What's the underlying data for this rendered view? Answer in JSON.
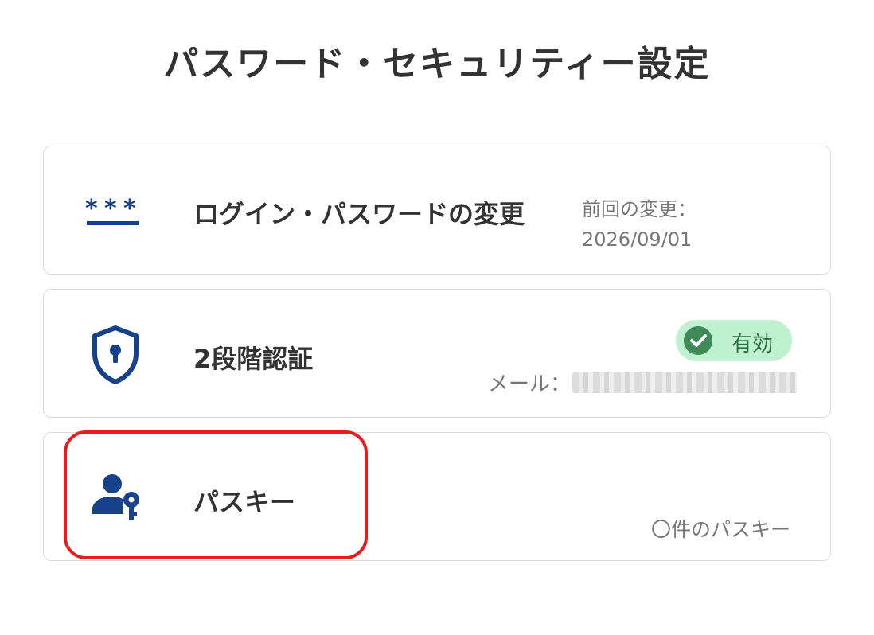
{
  "page": {
    "title": "パスワード・セキュリティー設定"
  },
  "colors": {
    "icon": "#17428a",
    "highlight": "#e81c1c",
    "badge_bg": "#bff0d0",
    "badge_check": "#3e8a58"
  },
  "cards": [
    {
      "icon": "password-asterisks-icon",
      "label": "ログイン・パスワードの変更",
      "last_changed_label": "前回の変更：",
      "last_changed_date": "2026/09/01"
    },
    {
      "icon": "shield-lock-icon",
      "label": "2段階認証",
      "status": "有効",
      "status_icon": "check-circle-icon",
      "email_label": "メール："
    },
    {
      "icon": "user-key-icon",
      "label": "パスキー",
      "count_text": "〇件のパスキー"
    }
  ]
}
